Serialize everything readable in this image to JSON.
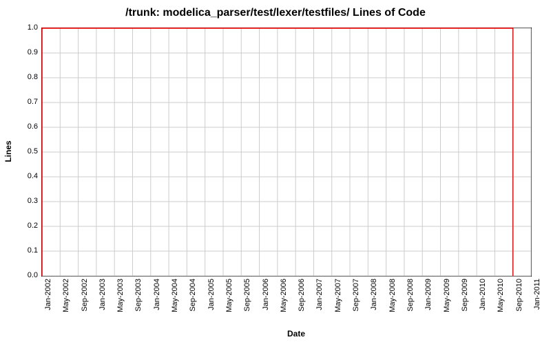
{
  "chart_data": {
    "type": "line",
    "title": "/trunk: modelica_parser/test/lexer/testfiles/ Lines of Code",
    "xlabel": "Date",
    "ylabel": "Lines",
    "ylim": [
      0.0,
      1.0
    ],
    "y_ticks": [
      0.0,
      0.1,
      0.2,
      0.3,
      0.4,
      0.5,
      0.6,
      0.7,
      0.8,
      0.9,
      1.0
    ],
    "x_ticks": [
      "Jan-2002",
      "May-2002",
      "Sep-2002",
      "Jan-2003",
      "May-2003",
      "Sep-2003",
      "Jan-2004",
      "May-2004",
      "Sep-2004",
      "Jan-2005",
      "May-2005",
      "Sep-2005",
      "Jan-2006",
      "May-2006",
      "Sep-2006",
      "Jan-2007",
      "May-2007",
      "Sep-2007",
      "Jan-2008",
      "May-2008",
      "Sep-2008",
      "Jan-2009",
      "May-2009",
      "Sep-2009",
      "Jan-2010",
      "May-2010",
      "Sep-2010",
      "Jan-2011"
    ],
    "series": [
      {
        "name": "Lines",
        "color": "#ff0000",
        "points": [
          {
            "x": "Jan-2002",
            "y": 0.0
          },
          {
            "x": "Jan-2002",
            "y": 1.0
          },
          {
            "x": "Sep-2010",
            "y": 1.0
          },
          {
            "x": "Sep-2010",
            "y": 0.0
          }
        ]
      }
    ]
  }
}
